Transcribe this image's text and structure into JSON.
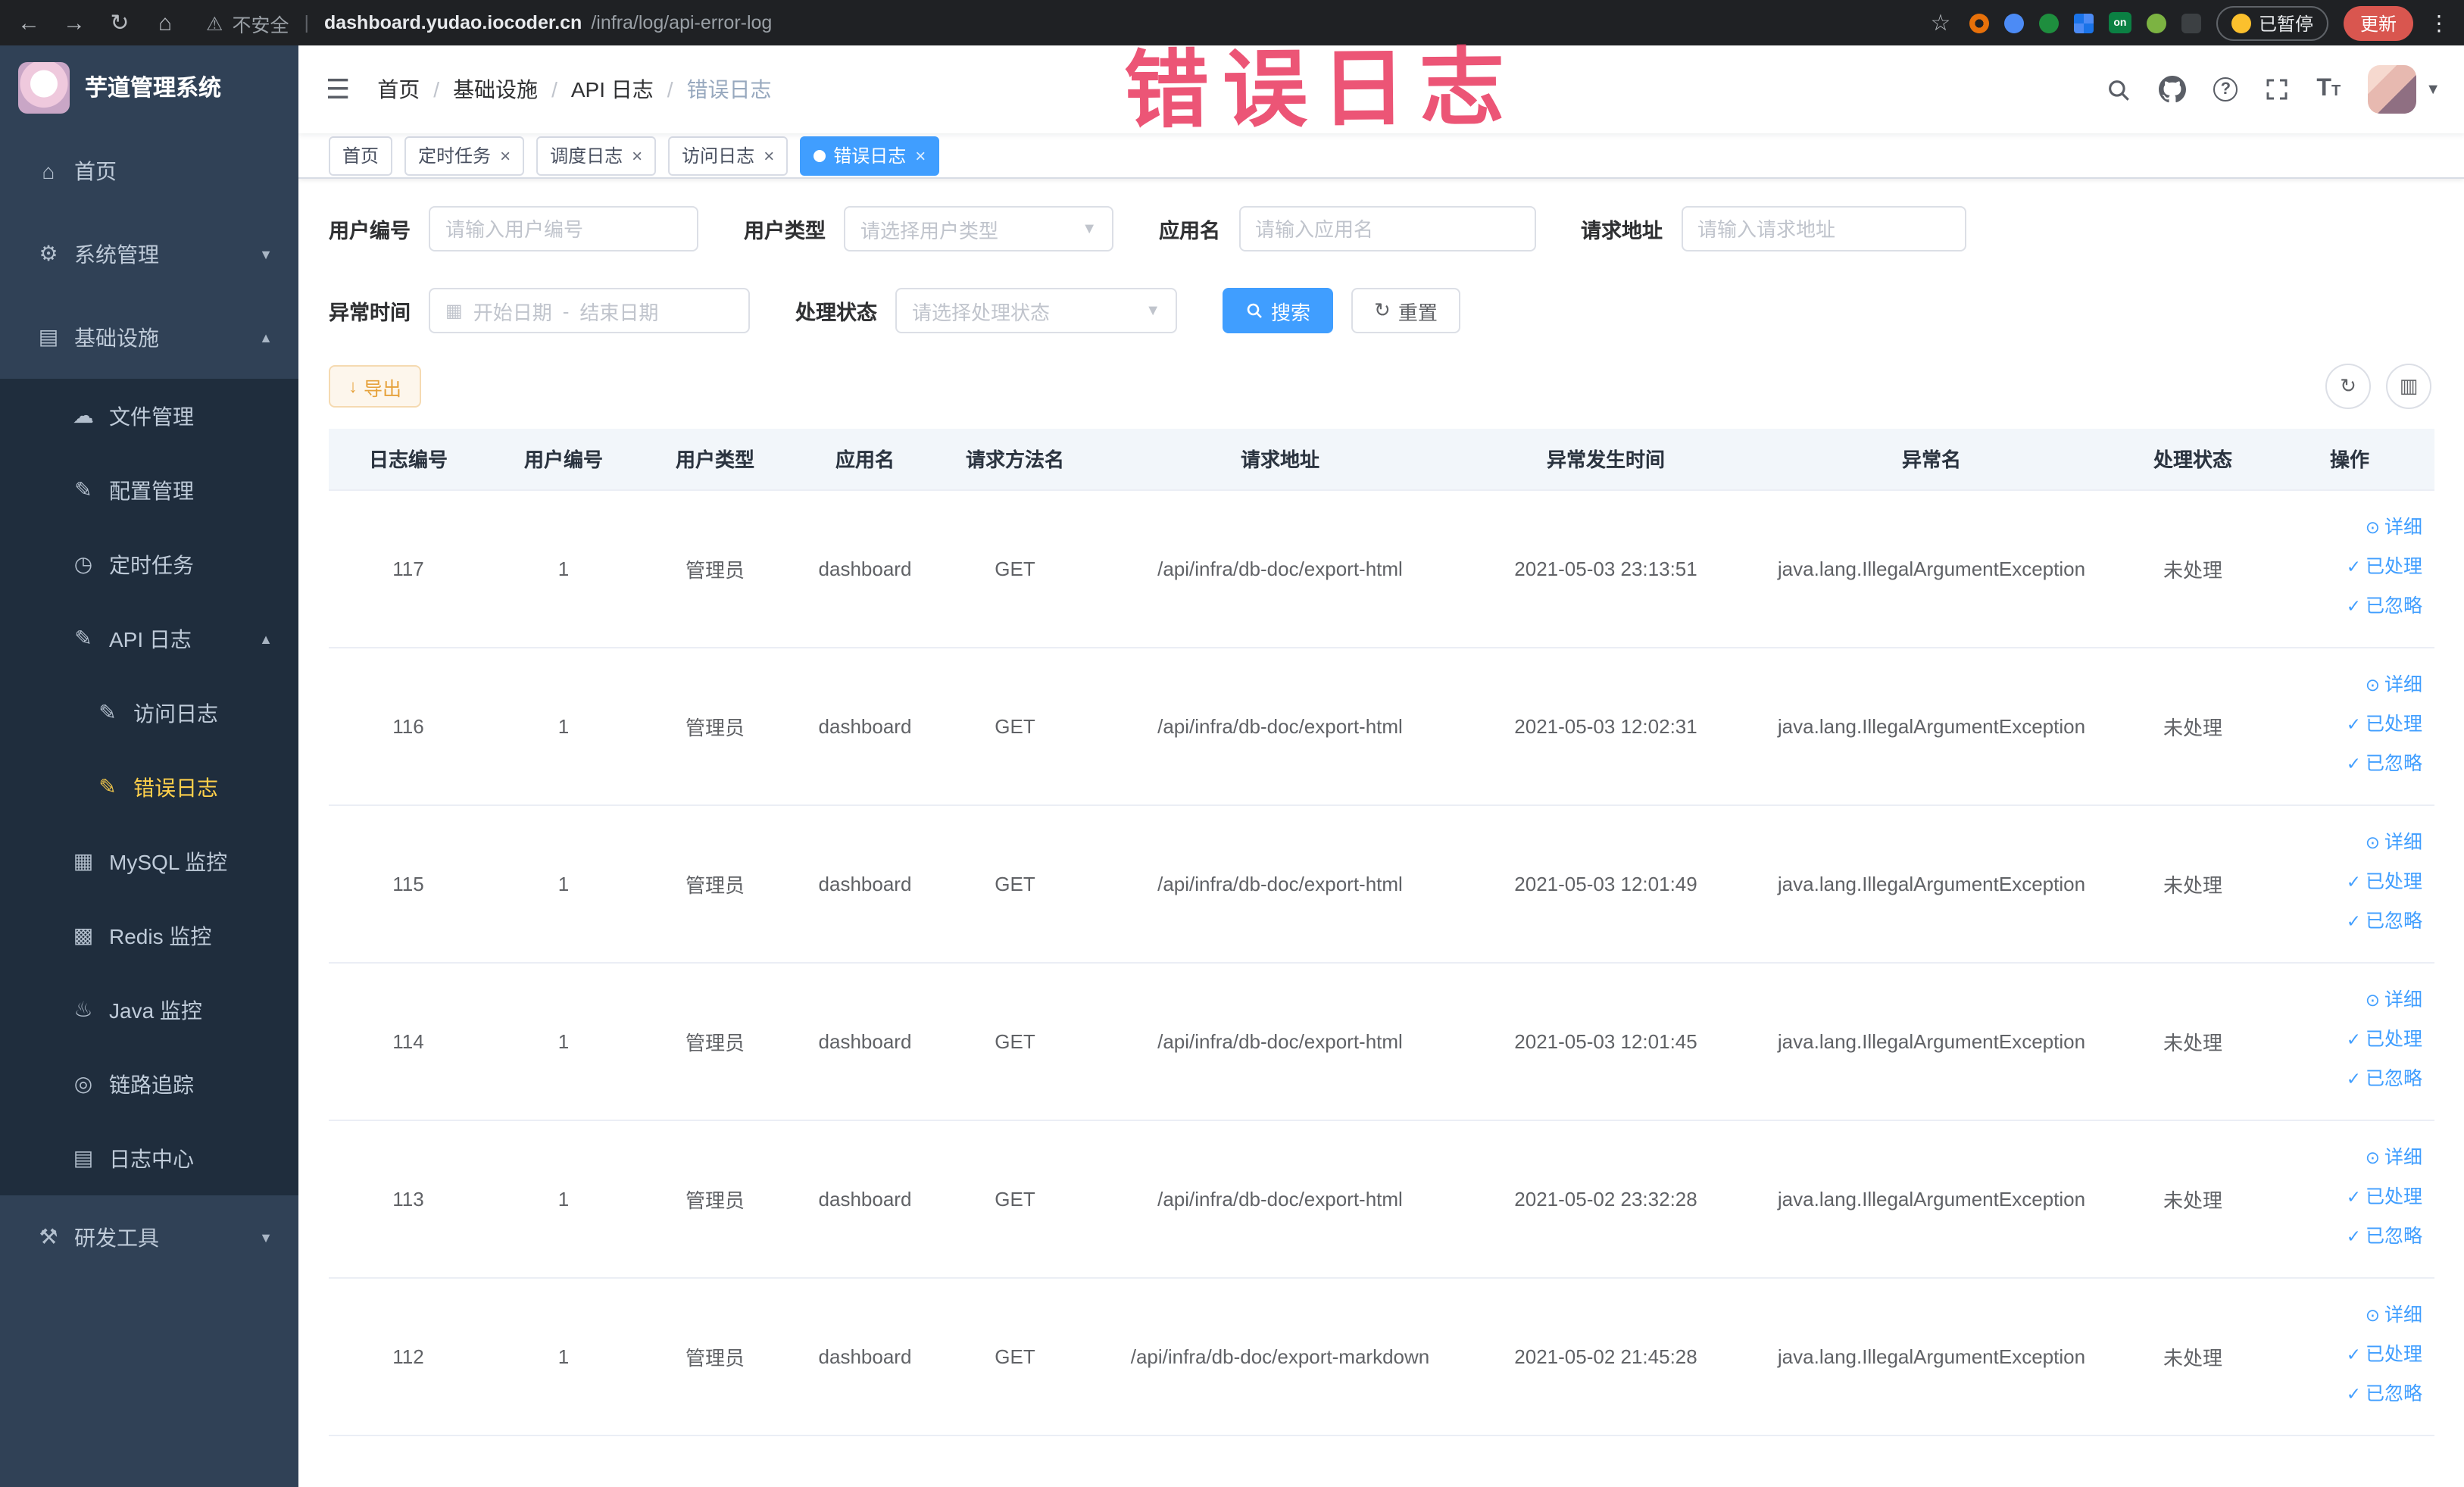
{
  "browser": {
    "security_label": "不安全",
    "url_host": "dashboard.yudao.iocoder.cn",
    "url_path": "/infra/log/api-error-log",
    "extension_badge_on": "on",
    "paused_button": "已暂停",
    "update_button": "更新"
  },
  "annotation": {
    "text": "错误日志"
  },
  "sidebar": {
    "logo_title": "芋道管理系统",
    "menu": [
      {
        "key": "home",
        "label": "首页",
        "level": 0,
        "icon": "home-icon",
        "glyph": "⌂"
      },
      {
        "key": "system-management",
        "label": "系统管理",
        "level": 0,
        "icon": "gear-icon",
        "glyph": "⚙",
        "arrow": "down"
      },
      {
        "key": "infrastructure",
        "label": "基础设施",
        "level": 0,
        "icon": "infra-icon",
        "glyph": "▤",
        "arrow": "up"
      },
      {
        "key": "file-management",
        "label": "文件管理",
        "level": 1,
        "icon": "cloud-icon",
        "glyph": "☁"
      },
      {
        "key": "config-management",
        "label": "配置管理",
        "level": 1,
        "icon": "edit-icon",
        "glyph": "✎"
      },
      {
        "key": "scheduled-tasks",
        "label": "定时任务",
        "level": 1,
        "icon": "clock-icon",
        "glyph": "◷"
      },
      {
        "key": "api-log",
        "label": "API 日志",
        "level": 1,
        "icon": "log-icon",
        "glyph": "✎",
        "arrow": "up"
      },
      {
        "key": "access-log",
        "label": "访问日志",
        "level": 2,
        "icon": "doc-icon",
        "glyph": "✎"
      },
      {
        "key": "error-log",
        "label": "错误日志",
        "level": 2,
        "icon": "doc-icon",
        "glyph": "✎",
        "active": true
      },
      {
        "key": "mysql-monitor",
        "label": "MySQL 监控",
        "level": 1,
        "icon": "mysql-icon",
        "glyph": "▦"
      },
      {
        "key": "redis-monitor",
        "label": "Redis 监控",
        "level": 1,
        "icon": "redis-icon",
        "glyph": "▩"
      },
      {
        "key": "java-monitor",
        "label": "Java 监控",
        "level": 1,
        "icon": "java-icon",
        "glyph": "♨"
      },
      {
        "key": "trace",
        "label": "链路追踪",
        "level": 1,
        "icon": "trace-icon",
        "glyph": "◎"
      },
      {
        "key": "log-center",
        "label": "日志中心",
        "level": 1,
        "icon": "log-center-icon",
        "glyph": "▤"
      },
      {
        "key": "dev-tools",
        "label": "研发工具",
        "level": 0,
        "icon": "tools-icon",
        "glyph": "⚒",
        "arrow": "down"
      }
    ]
  },
  "topbar": {
    "breadcrumb": [
      {
        "key": "home",
        "label": "首页",
        "current": false
      },
      {
        "key": "infrastructure",
        "label": "基础设施",
        "current": false
      },
      {
        "key": "api-log",
        "label": "API 日志",
        "current": false
      },
      {
        "key": "error-log",
        "label": "错误日志",
        "current": true
      }
    ]
  },
  "tabs": [
    {
      "key": "home",
      "label": "首页",
      "closable": false,
      "active": false
    },
    {
      "key": "scheduled-tasks",
      "label": "定时任务",
      "closable": true,
      "active": false
    },
    {
      "key": "schedule-log",
      "label": "调度日志",
      "closable": true,
      "active": false
    },
    {
      "key": "access-log",
      "label": "访问日志",
      "closable": true,
      "active": false
    },
    {
      "key": "error-log",
      "label": "错误日志",
      "closable": true,
      "active": true
    }
  ],
  "filters": {
    "user_id": {
      "label": "用户编号",
      "placeholder": "请输入用户编号"
    },
    "user_type": {
      "label": "用户类型",
      "placeholder": "请选择用户类型"
    },
    "app_name": {
      "label": "应用名",
      "placeholder": "请输入应用名"
    },
    "request_url": {
      "label": "请求地址",
      "placeholder": "请输入请求地址"
    },
    "exception_time": {
      "label": "异常时间",
      "start_placeholder": "开始日期",
      "separator": "-",
      "end_placeholder": "结束日期"
    },
    "process_status": {
      "label": "处理状态",
      "placeholder": "请选择处理状态"
    },
    "search_button": "搜索",
    "reset_button": "重置"
  },
  "toolbar": {
    "export_button": "导出"
  },
  "table": {
    "columns": [
      "日志编号",
      "用户编号",
      "用户类型",
      "应用名",
      "请求方法名",
      "请求地址",
      "异常发生时间",
      "异常名",
      "处理状态",
      "操作"
    ],
    "actions": [
      "详细",
      "已处理",
      "已忽略"
    ],
    "rows": [
      {
        "log_id": "117",
        "user_id": "1",
        "user_type": "管理员",
        "app_name": "dashboard",
        "method": "GET",
        "url": "/api/infra/db-doc/export-html",
        "time": "2021-05-03 23:13:51",
        "exception": "java.lang.IllegalArgumentException",
        "status": "未处理"
      },
      {
        "log_id": "116",
        "user_id": "1",
        "user_type": "管理员",
        "app_name": "dashboard",
        "method": "GET",
        "url": "/api/infra/db-doc/export-html",
        "time": "2021-05-03 12:02:31",
        "exception": "java.lang.IllegalArgumentException",
        "status": "未处理"
      },
      {
        "log_id": "115",
        "user_id": "1",
        "user_type": "管理员",
        "app_name": "dashboard",
        "method": "GET",
        "url": "/api/infra/db-doc/export-html",
        "time": "2021-05-03 12:01:49",
        "exception": "java.lang.IllegalArgumentException",
        "status": "未处理"
      },
      {
        "log_id": "114",
        "user_id": "1",
        "user_type": "管理员",
        "app_name": "dashboard",
        "method": "GET",
        "url": "/api/infra/db-doc/export-html",
        "time": "2021-05-03 12:01:45",
        "exception": "java.lang.IllegalArgumentException",
        "status": "未处理"
      },
      {
        "log_id": "113",
        "user_id": "1",
        "user_type": "管理员",
        "app_name": "dashboard",
        "method": "GET",
        "url": "/api/infra/db-doc/export-html",
        "time": "2021-05-02 23:32:28",
        "exception": "java.lang.IllegalArgumentException",
        "status": "未处理"
      },
      {
        "log_id": "112",
        "user_id": "1",
        "user_type": "管理员",
        "app_name": "dashboard",
        "method": "GET",
        "url": "/api/infra/db-doc/export-markdown",
        "time": "2021-05-02 21:45:28",
        "exception": "java.lang.IllegalArgumentException",
        "status": "未处理"
      }
    ]
  },
  "colors": {
    "primary": "#409eff",
    "sidebar_bg": "#304156",
    "submenu_bg": "#1f2d3d",
    "active_menu_text": "#ffd04b",
    "warning": "#e6a23c",
    "annotation": "#e93e63"
  }
}
